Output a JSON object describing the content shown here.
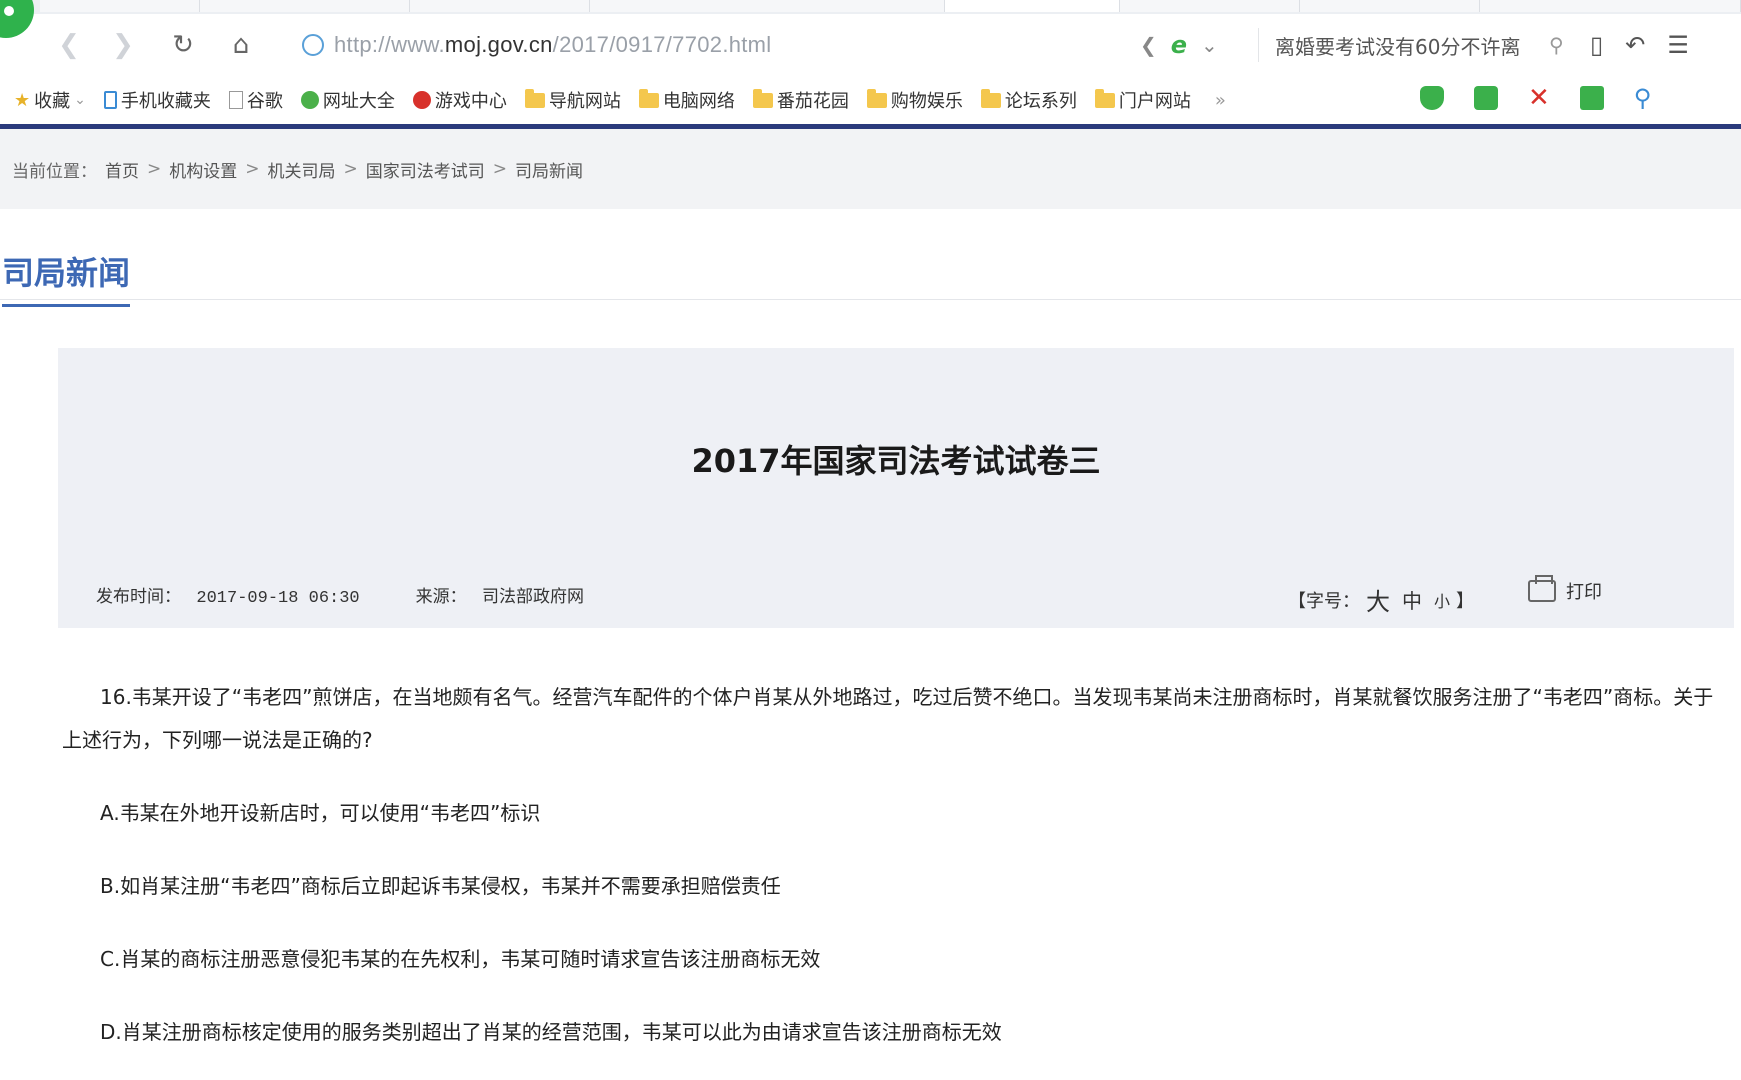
{
  "browser": {
    "url_prefix": "http://www.",
    "url_host": "moj.gov.cn",
    "url_path": "/2017/0917/7702.html",
    "search_query": "离婚要考试没有60分不许离",
    "favorites": [
      {
        "label": "收藏",
        "icon": "star-icon"
      },
      {
        "label": "手机收藏夹",
        "icon": "phone-icon"
      },
      {
        "label": "谷歌",
        "icon": "page-icon"
      },
      {
        "label": "网址大全",
        "icon": "site-icon"
      },
      {
        "label": "游戏中心",
        "icon": "game-icon"
      },
      {
        "label": "导航网站",
        "icon": "folder-icon"
      },
      {
        "label": "电脑网络",
        "icon": "folder-icon"
      },
      {
        "label": "番茄花园",
        "icon": "folder-icon"
      },
      {
        "label": "购物娱乐",
        "icon": "folder-icon"
      },
      {
        "label": "论坛系列",
        "icon": "folder-icon"
      },
      {
        "label": "门户网站",
        "icon": "folder-icon"
      }
    ],
    "favorites_more": "»"
  },
  "breadcrumb": {
    "prefix": "当前位置：",
    "items": [
      "首页",
      "机构设置",
      "机关司局",
      "国家司法考试司",
      "司局新闻"
    ],
    "separator": ">"
  },
  "section": {
    "title": "司局新闻"
  },
  "article": {
    "title": "2017年国家司法考试试卷三",
    "publish_label": "发布时间：",
    "publish_time": "2017-09-18 06:30",
    "source_label": "来源：",
    "source": "司法部政府网",
    "fontsize_open": "【字号：",
    "fontsize_large": "大",
    "fontsize_medium": "中",
    "fontsize_small": "小",
    "fontsize_close": "】",
    "print_label": "打印"
  },
  "content": {
    "question": "16.韦某开设了“韦老四”煎饼店，在当地颇有名气。经营汽车配件的个体户肖某从外地路过，吃过后赞不绝口。当发现韦某尚未注册商标时，肖某就餐饮服务注册了“韦老四”商标。关于上述行为，下列哪一说法是正确的?",
    "options": [
      "A.韦某在外地开设新店时，可以使用“韦老四”标识",
      "B.如肖某注册“韦老四”商标后立即起诉韦某侵权，韦某并不需要承担赔偿责任",
      "C.肖某的商标注册恶意侵犯韦某的在先权利，韦某可随时请求宣告该注册商标无效",
      "D.肖某注册商标核定使用的服务类别超出了肖某的经营范围，韦某可以此为由请求宣告该注册商标无效"
    ]
  }
}
